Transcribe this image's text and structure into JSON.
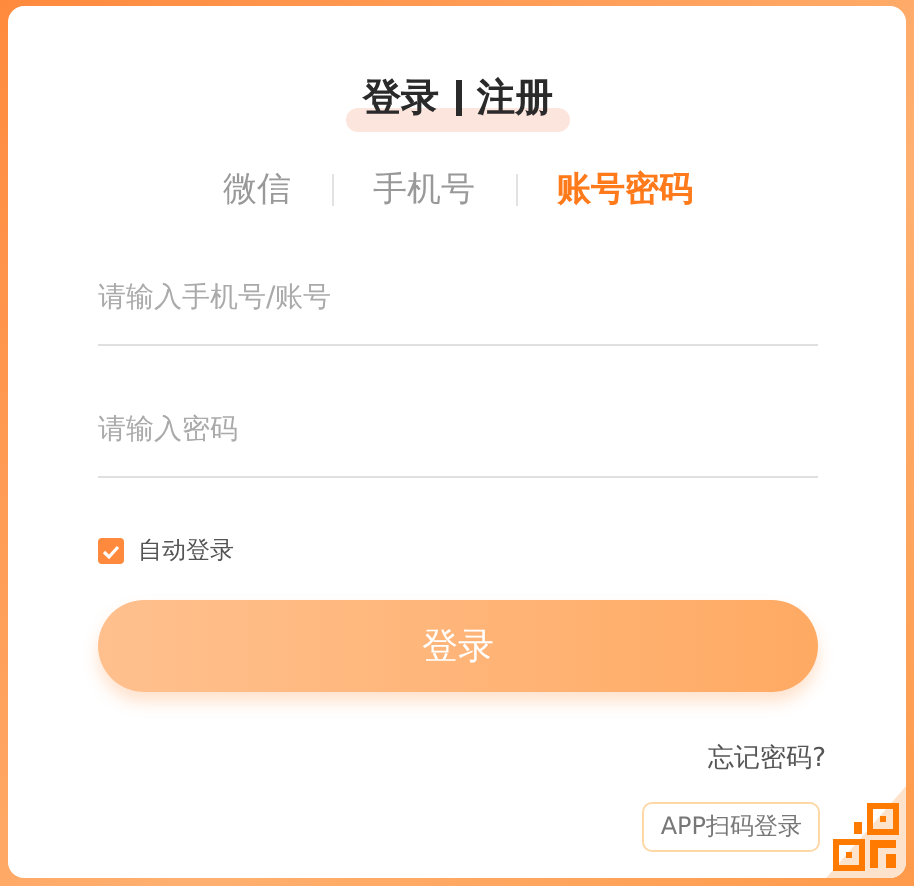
{
  "title": {
    "login": "登录",
    "register": "注册"
  },
  "tabs": [
    {
      "label": "微信",
      "selected": false
    },
    {
      "label": "手机号",
      "selected": false
    },
    {
      "label": "账号密码",
      "selected": true
    }
  ],
  "fields": [
    {
      "placeholder": "请输入手机号/账号"
    },
    {
      "placeholder": "请输入密码"
    }
  ],
  "auto_login": {
    "label": "自动登录",
    "checked": true
  },
  "submit": "登录",
  "forgot": "忘记密码?",
  "qr_tooltip": "APP扫码登录"
}
